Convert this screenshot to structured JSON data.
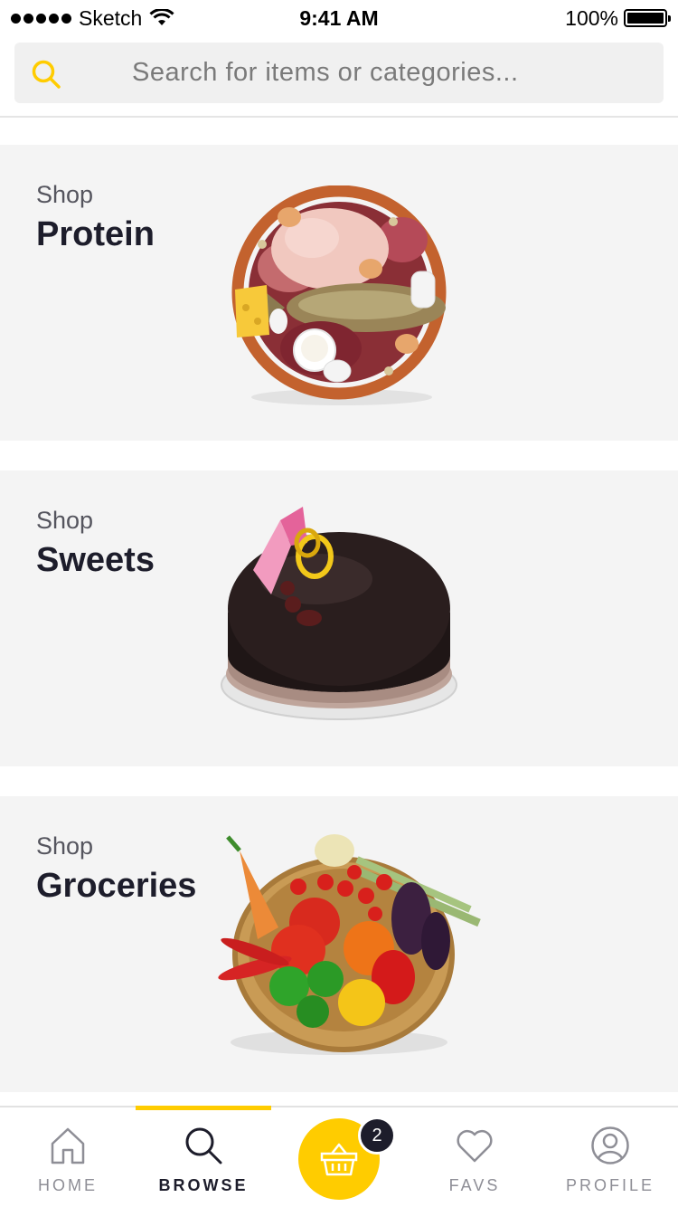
{
  "status_bar": {
    "carrier": "Sketch",
    "time": "9:41 AM",
    "battery": "100%"
  },
  "search": {
    "placeholder": "Search for items or categories...",
    "icon": "search-icon",
    "accent": "#ffcc00"
  },
  "categories": [
    {
      "prefix": "Shop",
      "title": "Protein",
      "image": "protein-platter"
    },
    {
      "prefix": "Shop",
      "title": "Sweets",
      "image": "chocolate-cake"
    },
    {
      "prefix": "Shop",
      "title": "Groceries",
      "image": "vegetable-basket"
    }
  ],
  "nav": {
    "home": "HOME",
    "browse": "BROWSE",
    "cart_count": "2",
    "favs": "FAVS",
    "profile": "PROFILE",
    "active": "browse"
  },
  "colors": {
    "accent": "#ffcc00",
    "card_bg": "#f4f4f4",
    "text": "#1d1d2b"
  }
}
